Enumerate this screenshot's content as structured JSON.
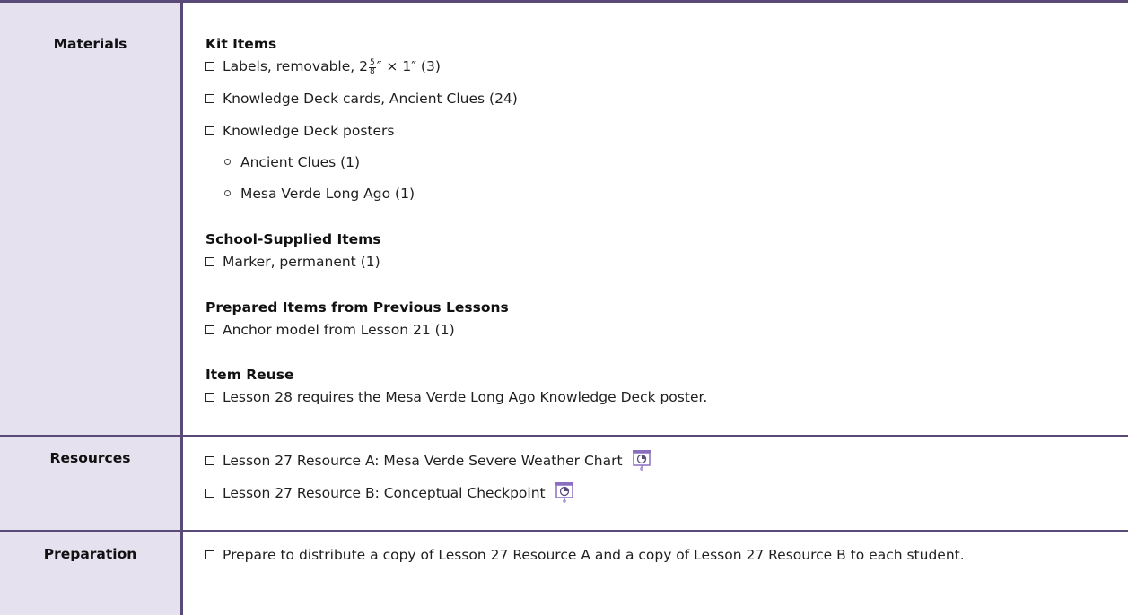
{
  "materials": {
    "label": "Materials",
    "kit_items": {
      "heading": "Kit Items",
      "labels_prefix": "Labels, removable, 2",
      "labels_frac_num": "5",
      "labels_frac_den": "8",
      "labels_suffix": "″ × 1″ (3)",
      "cards": "Knowledge Deck cards, Ancient Clues (24)",
      "posters": "Knowledge Deck posters",
      "poster_1": "Ancient Clues (1)",
      "poster_2": "Mesa Verde Long Ago (1)"
    },
    "school_supplied": {
      "heading": "School-Supplied Items",
      "item_1": "Marker, permanent (1)"
    },
    "prepared": {
      "heading": "Prepared Items from Previous Lessons",
      "item_1": "Anchor model from Lesson 21 (1)"
    },
    "reuse": {
      "heading": "Item Reuse",
      "item_1": "Lesson 28 requires the Mesa Verde Long Ago Knowledge Deck poster."
    }
  },
  "resources": {
    "label": "Resources",
    "item_1": "Lesson 27 Resource A: Mesa Verde Severe Weather Chart",
    "item_2": "Lesson 27 Resource B: Conceptual Checkpoint",
    "icon": "projector-screen-icon"
  },
  "preparation": {
    "label": "Preparation",
    "item_1": "Prepare to distribute a copy of Lesson 27 Resource A and a copy of Lesson 27 Resource B to each student."
  },
  "colors": {
    "border": "#5a4a78",
    "label_bg": "#e5e1ee",
    "icon_accent": "#8a6fc0"
  }
}
